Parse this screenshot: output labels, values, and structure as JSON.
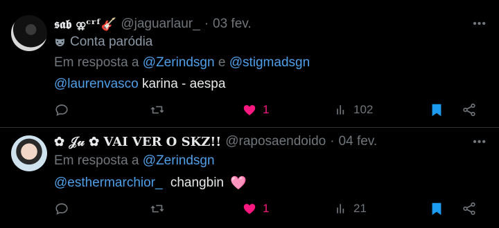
{
  "colors": {
    "background": "#000000",
    "text": "#e7e9ea",
    "muted": "#71767b",
    "link": "#4f9fe8",
    "like": "#f91880",
    "bookmark": "#1d9bf0",
    "divider": "#2f3336"
  },
  "tweets": [
    {
      "display_name": "𝖘𝖆𝖇 ⚢ᶜʳᶠ🎸",
      "handle": "@jaguarlaur_",
      "separator": "·",
      "date": "03 fev.",
      "more_icon": "more-horizontal-icon",
      "parody_label": "Conta paródia",
      "reply_prefix": "Em resposta a",
      "reply_mentions": [
        "@Zerindsgn",
        "@stigmadsgn"
      ],
      "reply_conjunction": "e",
      "text_mention": "@laurenvasco",
      "text": "karina - aespa",
      "actions": {
        "reply_icon": "reply-icon",
        "retweet_icon": "retweet-icon",
        "like_icon": "heart-filled-icon",
        "like_count": "1",
        "views_icon": "views-icon",
        "views_count": "102",
        "bookmark_icon": "bookmark-filled-icon",
        "share_icon": "share-icon"
      }
    },
    {
      "display_name": "✿ 𝒥𝓊 ✿ VAI VER O SKZ!!",
      "handle": "@raposaendoido",
      "separator": "·",
      "date": "04 fev.",
      "more_icon": "more-horizontal-icon",
      "reply_prefix": "Em resposta a",
      "reply_mentions": [
        "@Zerindsgn"
      ],
      "text_mention": "@esthermarchior_",
      "text": "changbin",
      "text_emoji": "🩷",
      "actions": {
        "reply_icon": "reply-icon",
        "retweet_icon": "retweet-icon",
        "like_icon": "heart-filled-icon",
        "like_count": "1",
        "views_icon": "views-icon",
        "views_count": "21",
        "bookmark_icon": "bookmark-filled-icon",
        "share_icon": "share-icon"
      }
    }
  ]
}
